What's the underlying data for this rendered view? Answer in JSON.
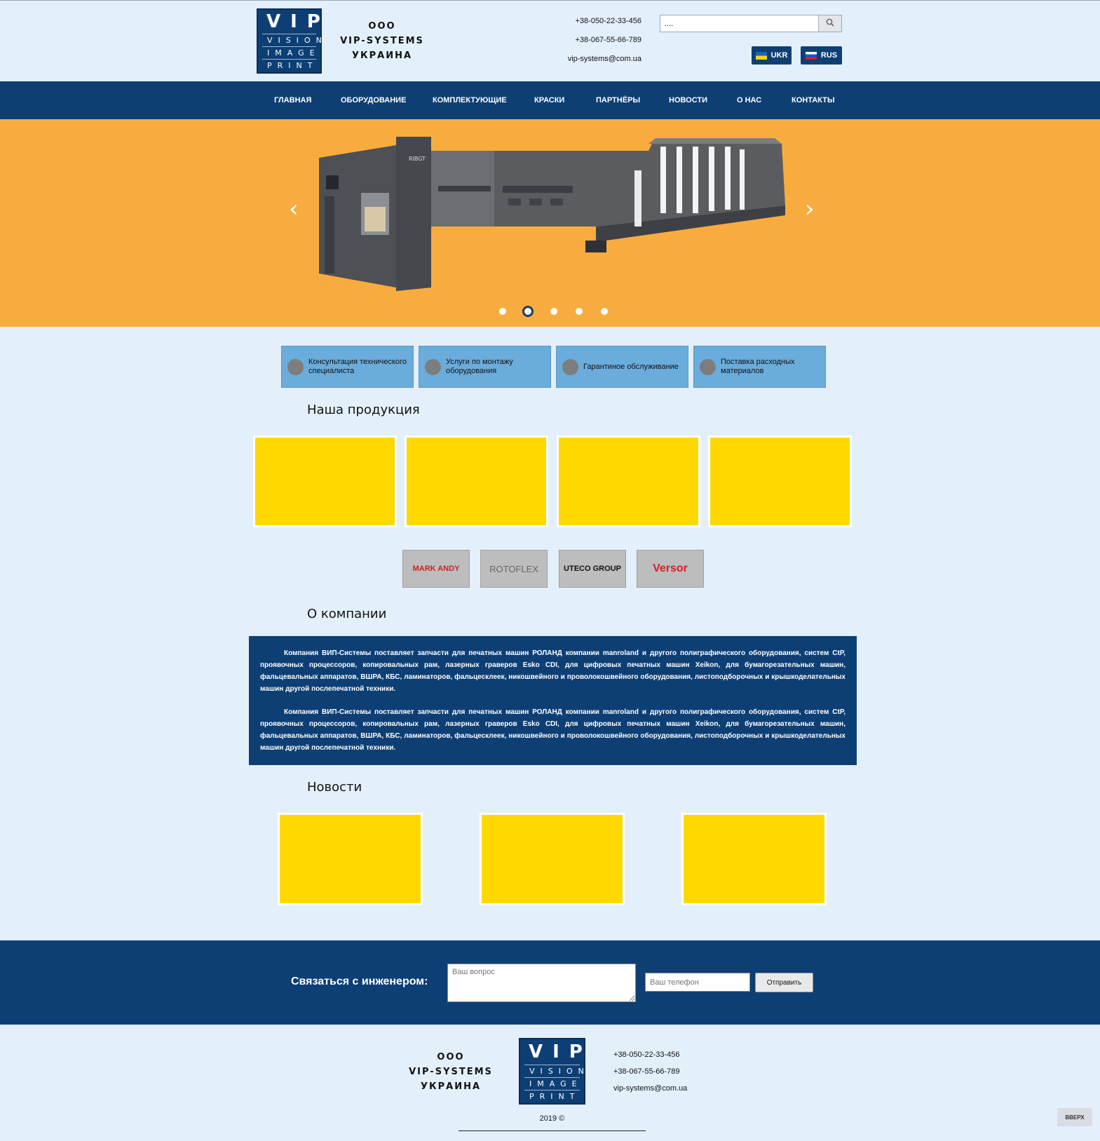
{
  "header": {
    "company_lines": [
      "ООО",
      "VIP-SYSTEMS",
      "УКРАИНА"
    ],
    "logo": {
      "big": "VIP",
      "lines": [
        "VISION",
        "IMAGE",
        "PRINT"
      ]
    },
    "phone1": "+38-050-22-33-456",
    "phone2": "+38-067-55-66-789",
    "email": "vip-systems@com.ua",
    "search_value": "....",
    "search_icon": "search-icon",
    "lang_ukr": "UKR",
    "lang_rus": "RUS"
  },
  "nav": {
    "items": [
      "ГЛАВНАЯ",
      "ОБОРУДОВАНИЕ",
      "КОМПЛЕКТУЮЩИЕ",
      "КРАСКИ",
      "ПАРТНЁРЫ",
      "НОВОСТИ",
      "О НАС",
      "КОНТАКТЫ"
    ]
  },
  "slider": {
    "prev": "‹",
    "next": "›",
    "machine_brand": "RIBGT",
    "dots": 5,
    "active_dot": 2
  },
  "services": [
    "Консультация технического специалиста",
    "Услуги по монтажу оборудования",
    "Гарантиное обслуживание",
    "Поставка расходных материалов"
  ],
  "products": {
    "title": "Наша продукция"
  },
  "partners": [
    "MARK ANDY",
    "ROTOFLEX",
    "UTECO GROUP",
    "Versor"
  ],
  "about": {
    "title": "О компании",
    "paragraphs": [
      "Компания ВИП-Системы поставляет запчасти для печатных машин РОЛАНД компании manroland и другого полиграфического оборудования, систем CtP, проявочных процессоров, копировальных рам, лазерных граверов Esko CDI, для цифровых печатных машин Xeikon, для бумагорезательных машин, фальцевальных аппаратов, ВШРА, КБС, ламинаторов, фальцесклеек, никошвейного и проволокошвейного оборудования, листоподборочных и крышкоделательных машин другой послепечатной техники.",
      "Компания ВИП-Системы поставляет запчасти для печатных машин РОЛАНД компании manroland и другого полиграфического оборудования, систем CtP, проявочных процессоров, копировальных рам, лазерных граверов Esko CDI, для цифровых печатных машин Xeikon, для бумагорезательных машин, фальцевальных аппаратов, ВШРА, КБС, ламинаторов, фальцесклеек, никошвейного и проволокошвейного оборудования, листоподборочных и крышкоделательных машин другой послепечатной техники."
    ]
  },
  "news": {
    "title": "Новости"
  },
  "contact_form": {
    "title": "Связаться с инженером:",
    "question_placeholder": "Ваш вопрос",
    "phone_placeholder": "Ваш телефон",
    "send_label": "Отправить"
  },
  "footer": {
    "company_lines": [
      "ООО",
      "VIP-SYSTEMS",
      "УКРАИНА"
    ],
    "logo": {
      "big": "VIP",
      "lines": [
        "VISION",
        "IMAGE",
        "PRINT"
      ]
    },
    "phone1": "+38-050-22-33-456",
    "phone2": "+38-067-55-66-789",
    "email": "vip-systems@com.ua",
    "copyright": "2019 ©",
    "to_top": "ВВЕРХ"
  },
  "colors": {
    "brand_blue": "#0d3f75",
    "background": "#e3f0fc",
    "slider_orange": "#f8ac40",
    "service_blue": "#6aacdb",
    "card_yellow": "#ffd800"
  }
}
